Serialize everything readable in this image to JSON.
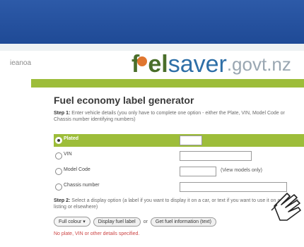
{
  "header": {
    "brand_left": "ieanoa",
    "logo": {
      "f": "f",
      "el": "el",
      "saver": "saver",
      "gov": ".govt.nz"
    }
  },
  "main": {
    "title": "Fuel economy label generator",
    "step1_label": "Step 1:",
    "step1_text": "Enter vehicle details (you only have to complete one option - either the Plate, VIN, Model Code or Chassis number identifying numbers)",
    "options": [
      {
        "label": "Plated",
        "selected": true
      },
      {
        "label": "VIN",
        "selected": false
      },
      {
        "label": "Model Code",
        "selected": false,
        "link": "(View models only)"
      },
      {
        "label": "Chassis number",
        "selected": false
      }
    ],
    "step2_label": "Step 2:",
    "step2_text": "Select a display option (a label if you want to display it on a car, or text if you want to use it on a website listing or elsewhere)",
    "select_value": "Full colour",
    "display_button": "Display fuel label",
    "or_text": "or",
    "info_button": "Get fuel information (text)",
    "error_text": "No plate, VIN or other details specified."
  },
  "colors": {
    "banner": "#2d5aa8",
    "accent_green": "#9dbd3a",
    "error": "#cc4444"
  },
  "icons": {
    "cursor": "pointer-hand-icon",
    "dropdown": "chevron-down-icon"
  }
}
